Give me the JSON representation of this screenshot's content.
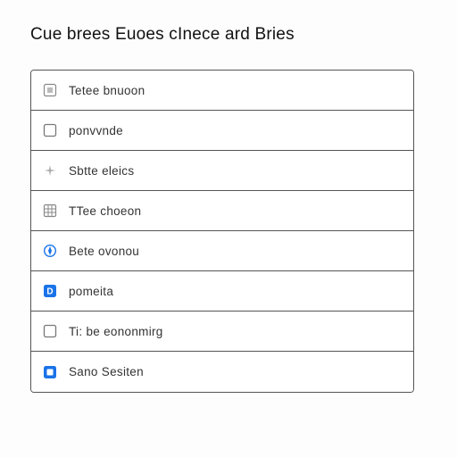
{
  "header": {
    "title": "Cue brees Euoes cInece ard Bries"
  },
  "list": {
    "items": [
      {
        "icon": "square-dotted-icon",
        "label": "Tetee bnuoon"
      },
      {
        "icon": "square-outline-icon",
        "label": "ponvvnde"
      },
      {
        "icon": "sparkle-icon",
        "label": "Sbtte eleics"
      },
      {
        "icon": "grid-icon",
        "label": "TTee choeon"
      },
      {
        "icon": "compass-icon",
        "label": "Bete ovonou"
      },
      {
        "icon": "square-d-icon",
        "label": "pomeita"
      },
      {
        "icon": "square-outline-icon",
        "label": "Ti: be eononmirg"
      },
      {
        "icon": "square-blue-icon",
        "label": "Sano Sesiten"
      }
    ]
  },
  "colors": {
    "accent_blue": "#1a73e8",
    "border": "#555555"
  }
}
